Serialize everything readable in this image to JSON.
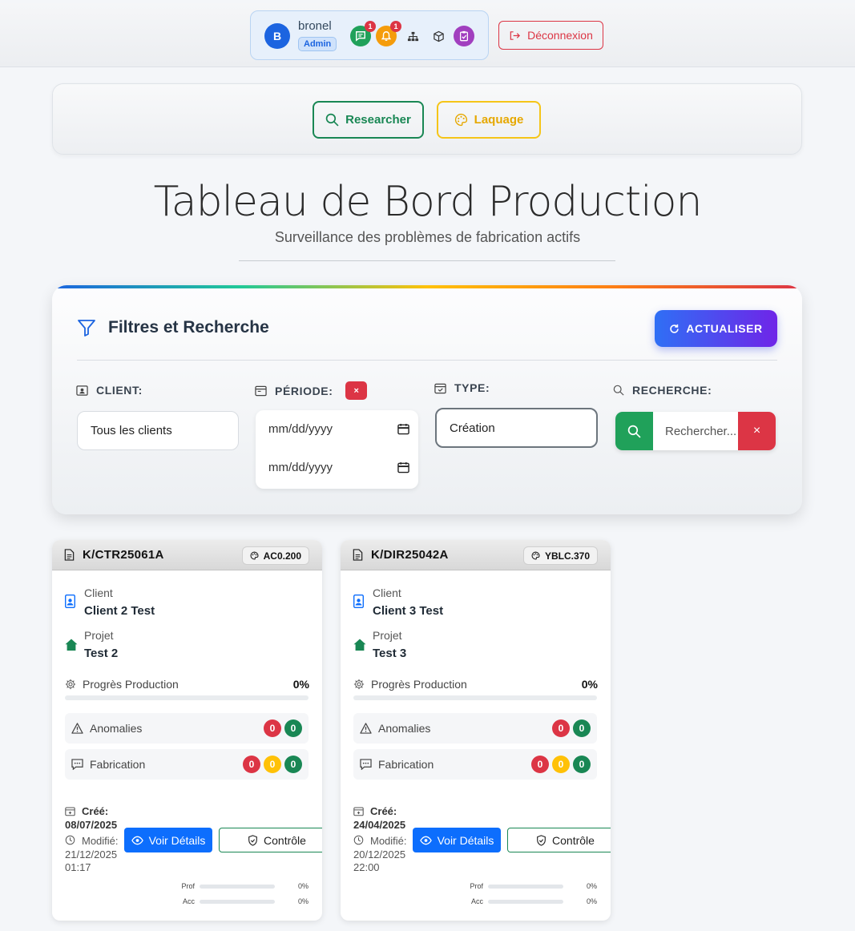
{
  "header": {
    "user_initial": "B",
    "username": "bronel",
    "role": "Admin",
    "messages_count": "1",
    "notifications_count": "1",
    "logout_label": "Déconnexion"
  },
  "nav": {
    "research_label": "Researcher",
    "laquage_label": "Laquage"
  },
  "page": {
    "title": "Tableau de Bord Production",
    "subtitle": "Surveillance des problèmes de fabrication actifs"
  },
  "filters": {
    "title": "Filtres et Recherche",
    "refresh_label": "ACTUALISER",
    "client_label": "CLIENT:",
    "client_value": "Tous les clients",
    "period_label": "PÉRIODE:",
    "period_clear": "×",
    "date_from": "mm/dd/yyyy",
    "date_to": "mm/dd/yyyy",
    "type_label": "TYPE:",
    "type_value": "Création",
    "search_label": "RECHERCHE:",
    "search_placeholder": "Rechercher...",
    "search_clear": "×"
  },
  "cards": [
    {
      "ref": "K/CTR25061A",
      "code": "AC0.200",
      "client_label": "Client",
      "client": "Client 2 Test",
      "project_label": "Projet",
      "project": "Test 2",
      "progress_label": "Progrès Production",
      "progress_value": "0%",
      "progress_fraction": 0,
      "anomalies_label": "Anomalies",
      "anomalies": [
        "0",
        "0"
      ],
      "fabrication_label": "Fabrication",
      "fabrication": [
        "0",
        "0",
        "0"
      ],
      "created_label": "Créé:",
      "created": "08/07/2025",
      "modified_label": "Modifié:",
      "modified_date": "21/12/2025",
      "modified_time": "01:17",
      "details_label": "Voir Détails",
      "control_label": "Contrôle",
      "prof_label": "Prof",
      "prof_value": "0%",
      "acc_label": "Acc",
      "acc_value": "0%"
    },
    {
      "ref": "K/DIR25042A",
      "code": "YBLC.370",
      "client_label": "Client",
      "client": "Client 3 Test",
      "project_label": "Projet",
      "project": "Test 3",
      "progress_label": "Progrès Production",
      "progress_value": "0%",
      "progress_fraction": 0,
      "anomalies_label": "Anomalies",
      "anomalies": [
        "0",
        "0"
      ],
      "fabrication_label": "Fabrication",
      "fabrication": [
        "0",
        "0",
        "0"
      ],
      "created_label": "Créé:",
      "created": "24/04/2025",
      "modified_label": "Modifié:",
      "modified_date": "20/12/2025",
      "modified_time": "22:00",
      "details_label": "Voir Détails",
      "control_label": "Contrôle",
      "prof_label": "Prof",
      "prof_value": "0%",
      "acc_label": "Acc",
      "acc_value": "0%"
    }
  ]
}
